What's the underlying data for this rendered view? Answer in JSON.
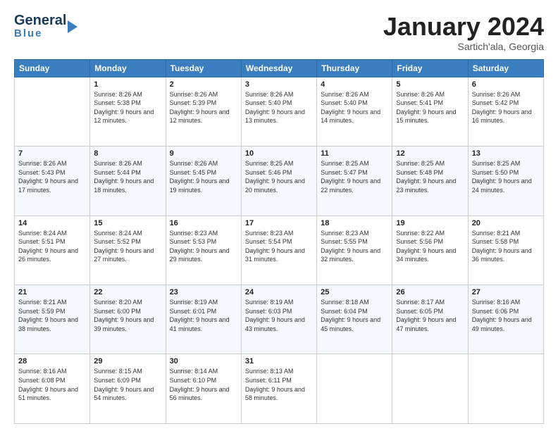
{
  "header": {
    "logo_line1": "General",
    "logo_line2": "Blue",
    "month_title": "January 2024",
    "subtitle": "Sartich'ala, Georgia"
  },
  "weekdays": [
    "Sunday",
    "Monday",
    "Tuesday",
    "Wednesday",
    "Thursday",
    "Friday",
    "Saturday"
  ],
  "weeks": [
    [
      {
        "day": "",
        "sunrise": "",
        "sunset": "",
        "daylight": ""
      },
      {
        "day": "1",
        "sunrise": "Sunrise: 8:26 AM",
        "sunset": "Sunset: 5:38 PM",
        "daylight": "Daylight: 9 hours and 12 minutes."
      },
      {
        "day": "2",
        "sunrise": "Sunrise: 8:26 AM",
        "sunset": "Sunset: 5:39 PM",
        "daylight": "Daylight: 9 hours and 12 minutes."
      },
      {
        "day": "3",
        "sunrise": "Sunrise: 8:26 AM",
        "sunset": "Sunset: 5:40 PM",
        "daylight": "Daylight: 9 hours and 13 minutes."
      },
      {
        "day": "4",
        "sunrise": "Sunrise: 8:26 AM",
        "sunset": "Sunset: 5:40 PM",
        "daylight": "Daylight: 9 hours and 14 minutes."
      },
      {
        "day": "5",
        "sunrise": "Sunrise: 8:26 AM",
        "sunset": "Sunset: 5:41 PM",
        "daylight": "Daylight: 9 hours and 15 minutes."
      },
      {
        "day": "6",
        "sunrise": "Sunrise: 8:26 AM",
        "sunset": "Sunset: 5:42 PM",
        "daylight": "Daylight: 9 hours and 16 minutes."
      }
    ],
    [
      {
        "day": "7",
        "sunrise": "Sunrise: 8:26 AM",
        "sunset": "Sunset: 5:43 PM",
        "daylight": "Daylight: 9 hours and 17 minutes."
      },
      {
        "day": "8",
        "sunrise": "Sunrise: 8:26 AM",
        "sunset": "Sunset: 5:44 PM",
        "daylight": "Daylight: 9 hours and 18 minutes."
      },
      {
        "day": "9",
        "sunrise": "Sunrise: 8:26 AM",
        "sunset": "Sunset: 5:45 PM",
        "daylight": "Daylight: 9 hours and 19 minutes."
      },
      {
        "day": "10",
        "sunrise": "Sunrise: 8:25 AM",
        "sunset": "Sunset: 5:46 PM",
        "daylight": "Daylight: 9 hours and 20 minutes."
      },
      {
        "day": "11",
        "sunrise": "Sunrise: 8:25 AM",
        "sunset": "Sunset: 5:47 PM",
        "daylight": "Daylight: 9 hours and 22 minutes."
      },
      {
        "day": "12",
        "sunrise": "Sunrise: 8:25 AM",
        "sunset": "Sunset: 5:48 PM",
        "daylight": "Daylight: 9 hours and 23 minutes."
      },
      {
        "day": "13",
        "sunrise": "Sunrise: 8:25 AM",
        "sunset": "Sunset: 5:50 PM",
        "daylight": "Daylight: 9 hours and 24 minutes."
      }
    ],
    [
      {
        "day": "14",
        "sunrise": "Sunrise: 8:24 AM",
        "sunset": "Sunset: 5:51 PM",
        "daylight": "Daylight: 9 hours and 26 minutes."
      },
      {
        "day": "15",
        "sunrise": "Sunrise: 8:24 AM",
        "sunset": "Sunset: 5:52 PM",
        "daylight": "Daylight: 9 hours and 27 minutes."
      },
      {
        "day": "16",
        "sunrise": "Sunrise: 8:23 AM",
        "sunset": "Sunset: 5:53 PM",
        "daylight": "Daylight: 9 hours and 29 minutes."
      },
      {
        "day": "17",
        "sunrise": "Sunrise: 8:23 AM",
        "sunset": "Sunset: 5:54 PM",
        "daylight": "Daylight: 9 hours and 31 minutes."
      },
      {
        "day": "18",
        "sunrise": "Sunrise: 8:23 AM",
        "sunset": "Sunset: 5:55 PM",
        "daylight": "Daylight: 9 hours and 32 minutes."
      },
      {
        "day": "19",
        "sunrise": "Sunrise: 8:22 AM",
        "sunset": "Sunset: 5:56 PM",
        "daylight": "Daylight: 9 hours and 34 minutes."
      },
      {
        "day": "20",
        "sunrise": "Sunrise: 8:21 AM",
        "sunset": "Sunset: 5:58 PM",
        "daylight": "Daylight: 9 hours and 36 minutes."
      }
    ],
    [
      {
        "day": "21",
        "sunrise": "Sunrise: 8:21 AM",
        "sunset": "Sunset: 5:59 PM",
        "daylight": "Daylight: 9 hours and 38 minutes."
      },
      {
        "day": "22",
        "sunrise": "Sunrise: 8:20 AM",
        "sunset": "Sunset: 6:00 PM",
        "daylight": "Daylight: 9 hours and 39 minutes."
      },
      {
        "day": "23",
        "sunrise": "Sunrise: 8:19 AM",
        "sunset": "Sunset: 6:01 PM",
        "daylight": "Daylight: 9 hours and 41 minutes."
      },
      {
        "day": "24",
        "sunrise": "Sunrise: 8:19 AM",
        "sunset": "Sunset: 6:03 PM",
        "daylight": "Daylight: 9 hours and 43 minutes."
      },
      {
        "day": "25",
        "sunrise": "Sunrise: 8:18 AM",
        "sunset": "Sunset: 6:04 PM",
        "daylight": "Daylight: 9 hours and 45 minutes."
      },
      {
        "day": "26",
        "sunrise": "Sunrise: 8:17 AM",
        "sunset": "Sunset: 6:05 PM",
        "daylight": "Daylight: 9 hours and 47 minutes."
      },
      {
        "day": "27",
        "sunrise": "Sunrise: 8:16 AM",
        "sunset": "Sunset: 6:06 PM",
        "daylight": "Daylight: 9 hours and 49 minutes."
      }
    ],
    [
      {
        "day": "28",
        "sunrise": "Sunrise: 8:16 AM",
        "sunset": "Sunset: 6:08 PM",
        "daylight": "Daylight: 9 hours and 51 minutes."
      },
      {
        "day": "29",
        "sunrise": "Sunrise: 8:15 AM",
        "sunset": "Sunset: 6:09 PM",
        "daylight": "Daylight: 9 hours and 54 minutes."
      },
      {
        "day": "30",
        "sunrise": "Sunrise: 8:14 AM",
        "sunset": "Sunset: 6:10 PM",
        "daylight": "Daylight: 9 hours and 56 minutes."
      },
      {
        "day": "31",
        "sunrise": "Sunrise: 8:13 AM",
        "sunset": "Sunset: 6:11 PM",
        "daylight": "Daylight: 9 hours and 58 minutes."
      },
      {
        "day": "",
        "sunrise": "",
        "sunset": "",
        "daylight": ""
      },
      {
        "day": "",
        "sunrise": "",
        "sunset": "",
        "daylight": ""
      },
      {
        "day": "",
        "sunrise": "",
        "sunset": "",
        "daylight": ""
      }
    ]
  ]
}
